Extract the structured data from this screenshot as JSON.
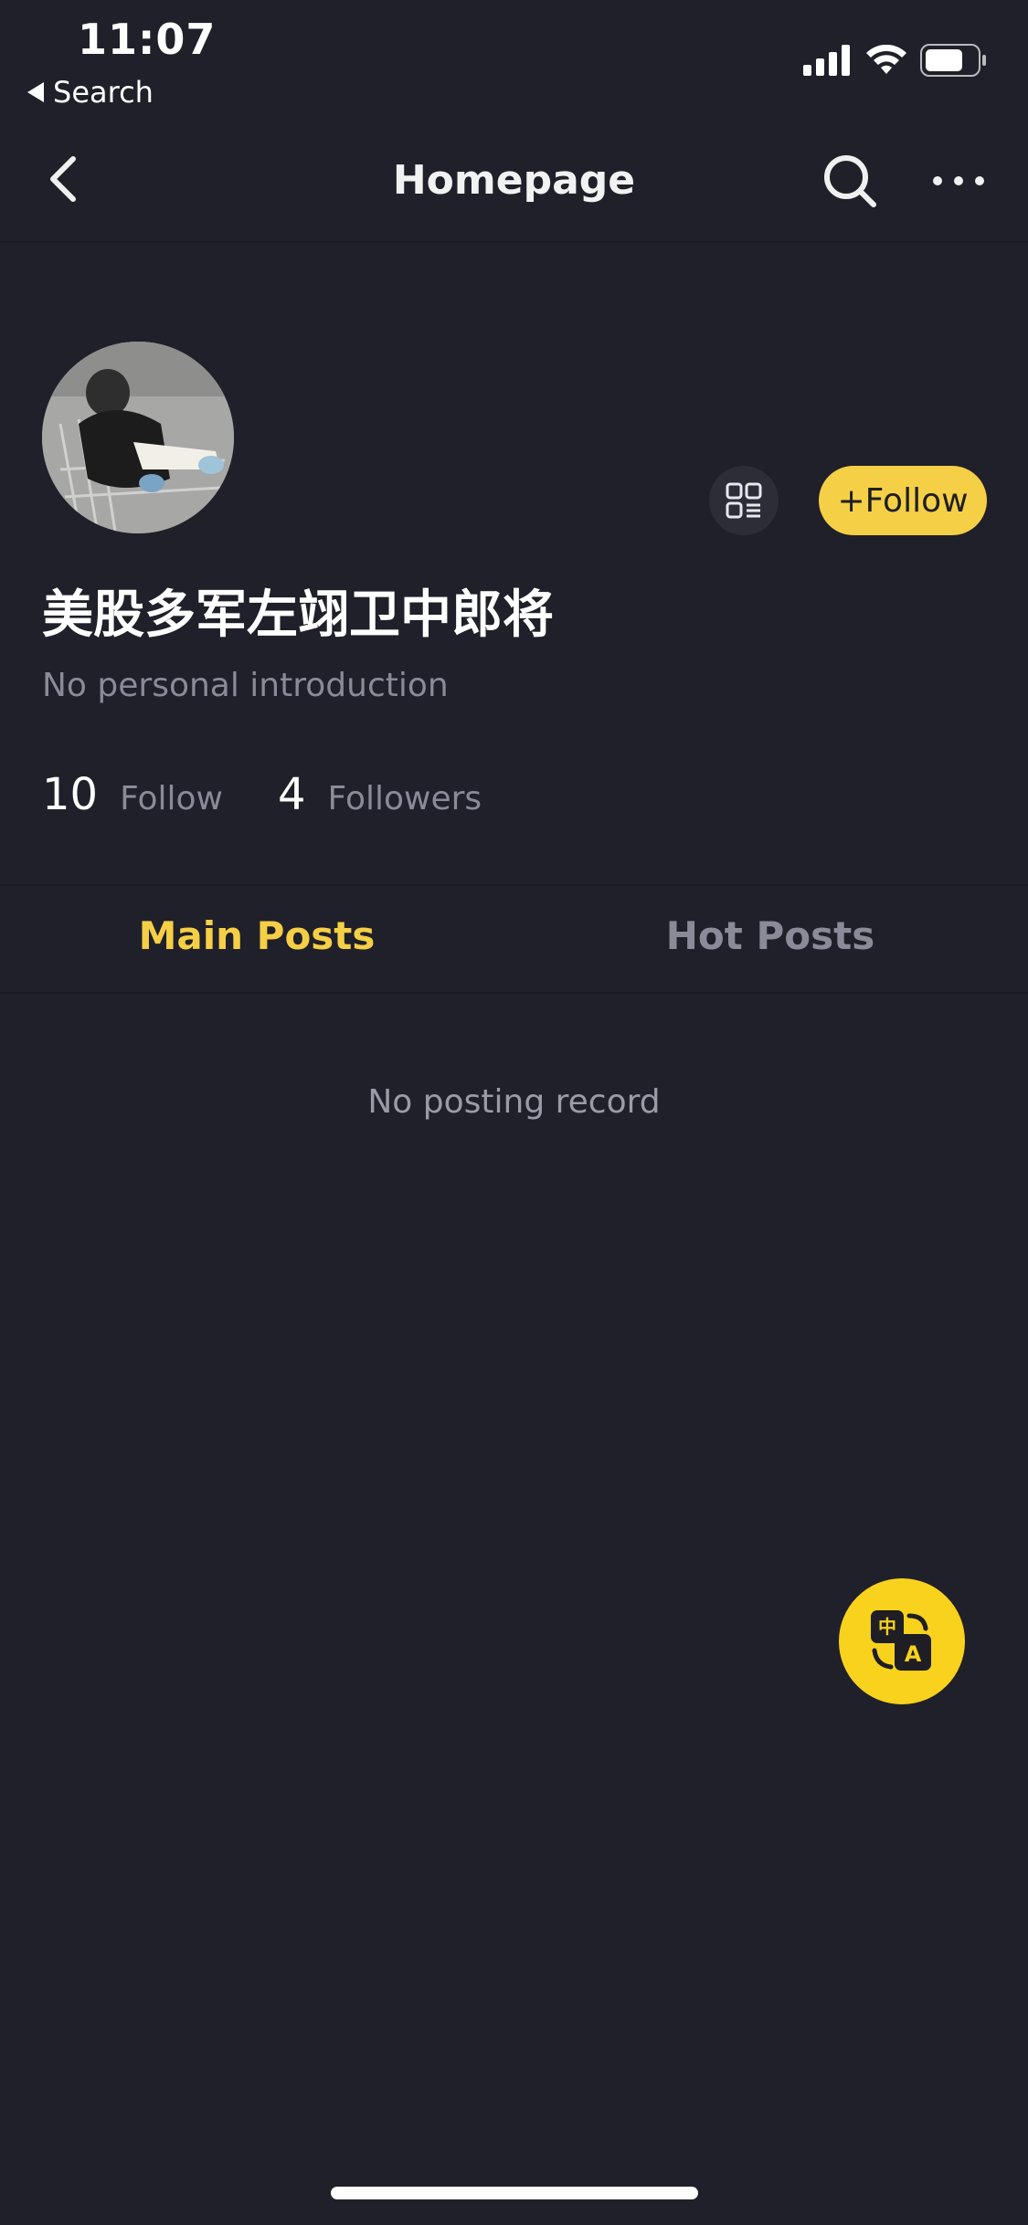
{
  "status_bar": {
    "time": "11:07",
    "back_label": "Search"
  },
  "nav": {
    "title": "Homepage"
  },
  "profile": {
    "name": "美股多军左翊卫中郎将",
    "intro": "No personal introduction",
    "follow_button": "+Follow",
    "stats": {
      "follow_count": "10",
      "follow_label": "Follow",
      "followers_count": "4",
      "followers_label": "Followers"
    }
  },
  "tabs": [
    {
      "label": "Main Posts",
      "active": true
    },
    {
      "label": "Hot Posts",
      "active": false
    }
  ],
  "empty_state": "No posting record",
  "fab": {
    "icon": "translate-icon",
    "glyph_top": "中",
    "glyph_bottom": "A"
  },
  "colors": {
    "background": "#20202a",
    "accent": "#f5cf45",
    "muted": "#8a8a98"
  }
}
